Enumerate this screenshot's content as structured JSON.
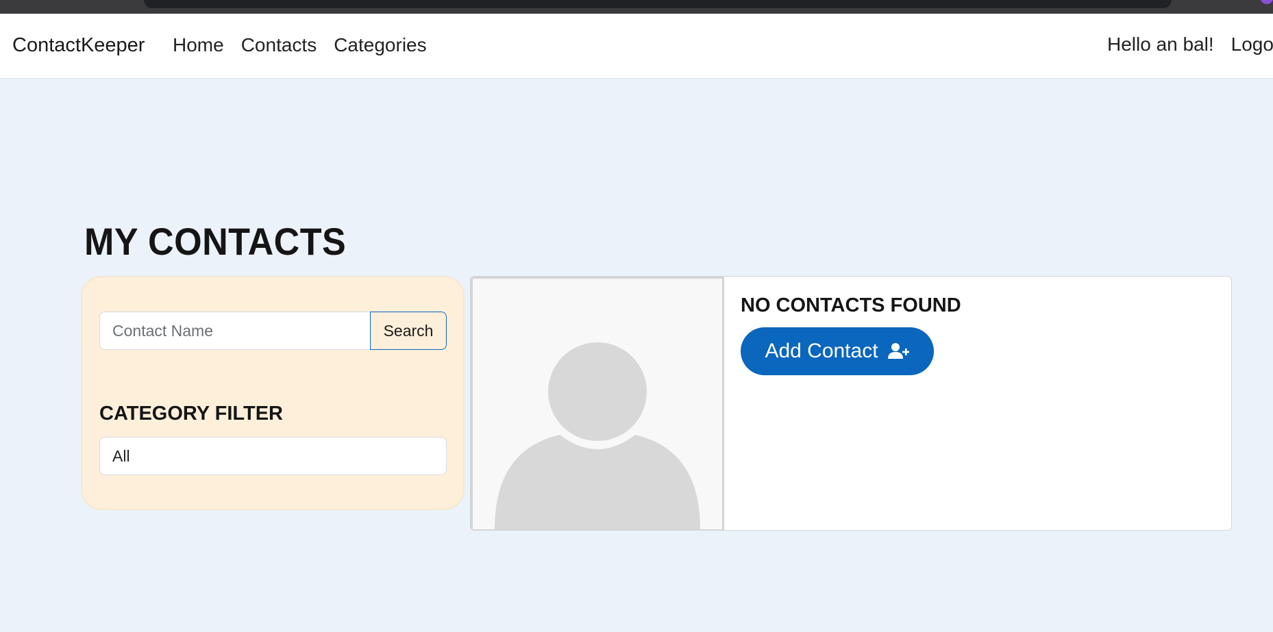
{
  "navbar": {
    "brand": "ContactKeeper",
    "links": [
      "Home",
      "Contacts",
      "Categories"
    ],
    "greeting": "Hello an bal!",
    "logout": "Logout"
  },
  "page": {
    "title": "MY CONTACTS"
  },
  "filters": {
    "search_placeholder": "Contact Name",
    "search_value": "",
    "search_button": "Search",
    "category_heading": "CATEGORY FILTER",
    "category_selected": "All"
  },
  "contacts": {
    "empty_message": "NO CONTACTS FOUND",
    "add_button": "Add Contact",
    "add_icon": "user-plus-icon",
    "avatar_icon": "person-placeholder-icon"
  },
  "colors": {
    "page_bg": "#ebf2fa",
    "filter_card_bg": "#fdefd9",
    "primary": "#0b66bd",
    "avatar_fill": "#d8d8d8"
  }
}
